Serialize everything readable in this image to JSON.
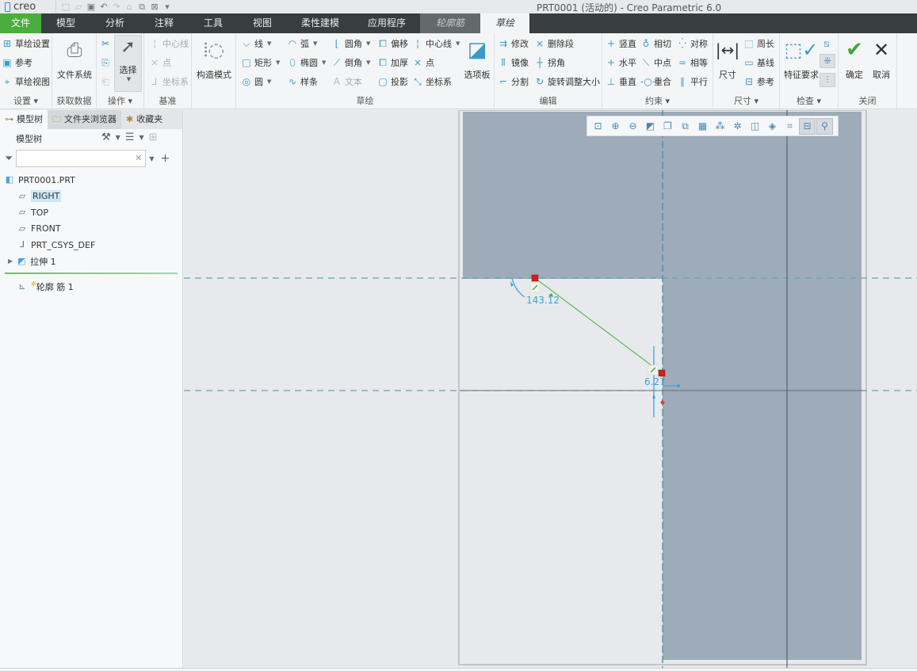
{
  "app": {
    "logo": "creo",
    "window_title": "PRT0001 (活动的) - Creo Parametric 6.0"
  },
  "quick_access": [
    {
      "icon": "new-file-icon",
      "glyph": "□",
      "dim": true
    },
    {
      "icon": "open-file-icon",
      "glyph": "▱",
      "dim": true
    },
    {
      "icon": "save-icon",
      "glyph": "▣",
      "dim": false
    },
    {
      "icon": "undo-icon",
      "glyph": "↶",
      "dim": false
    },
    {
      "icon": "redo-icon",
      "glyph": "↷",
      "dim": true
    },
    {
      "icon": "regenerate-icon",
      "glyph": "⌂",
      "dim": true
    },
    {
      "icon": "windows-icon",
      "glyph": "⧉",
      "dim": false
    },
    {
      "icon": "close-window-icon",
      "glyph": "⊠",
      "dim": false
    },
    {
      "icon": "customize-icon",
      "glyph": "▾",
      "dim": false
    }
  ],
  "tabs": [
    {
      "label": "文件",
      "kind": "file",
      "width": 52
    },
    {
      "label": "模型",
      "kind": "normal",
      "width": 62
    },
    {
      "label": "分析",
      "kind": "normal",
      "width": 62
    },
    {
      "label": "注释",
      "kind": "normal",
      "width": 62
    },
    {
      "label": "工具",
      "kind": "normal",
      "width": 62
    },
    {
      "label": "视图",
      "kind": "normal",
      "width": 62
    },
    {
      "label": "柔性建模",
      "kind": "normal",
      "width": 84
    },
    {
      "label": "应用程序",
      "kind": "normal",
      "width": 84
    },
    {
      "label": "轮廓筋",
      "kind": "ctx",
      "width": 76
    },
    {
      "label": "草绘",
      "kind": "active",
      "width": 62
    }
  ],
  "ribbon": {
    "setup": {
      "label": "设置 ▾",
      "items": [
        {
          "label": "草绘设置",
          "icon": "sketch-setup-icon",
          "glyph": "⊞"
        },
        {
          "label": "参考",
          "icon": "references-icon",
          "glyph": "▣"
        },
        {
          "label": "草绘视图",
          "icon": "sketch-view-icon",
          "glyph": "⌖"
        }
      ]
    },
    "get_data": {
      "label": "获取数据",
      "file_system": "文件系统"
    },
    "operations": {
      "label": "操作 ▾",
      "select": "选择",
      "cut_icon": "✂",
      "copy_icon": "⎘",
      "paste_icon": "⎗"
    },
    "datum": {
      "label": "基准",
      "items": [
        {
          "label": "中心线",
          "icon": "centerline-icon",
          "glyph": "¦"
        },
        {
          "label": "点",
          "icon": "point-icon",
          "glyph": "×"
        },
        {
          "label": "坐标系",
          "icon": "csys-icon",
          "glyph": "⅃"
        }
      ]
    },
    "construction": {
      "label": "构造模式"
    },
    "sketching": {
      "label": "草绘",
      "col1": [
        {
          "label": "线",
          "icon": "line-icon",
          "glyph": "⌵",
          "dropdown": true
        },
        {
          "label": "矩形",
          "icon": "rectangle-icon",
          "glyph": "□",
          "dropdown": true
        },
        {
          "label": "圆",
          "icon": "circle-icon",
          "glyph": "◎",
          "dropdown": true
        }
      ],
      "col2": [
        {
          "label": "弧",
          "icon": "arc-icon",
          "glyph": "◠",
          "dropdown": true
        },
        {
          "label": "椭圆",
          "icon": "ellipse-icon",
          "glyph": "⬯",
          "dropdown": true
        },
        {
          "label": "样条",
          "icon": "spline-icon",
          "glyph": "∿",
          "dropdown": false
        }
      ],
      "col3": [
        {
          "label": "圆角",
          "icon": "fillet-icon",
          "glyph": "⌊",
          "dropdown": true
        },
        {
          "label": "倒角",
          "icon": "chamfer-icon",
          "glyph": "⟋",
          "dropdown": true
        },
        {
          "label": "文本",
          "icon": "text-icon",
          "glyph": "A",
          "dropdown": false,
          "dim": true
        }
      ],
      "col4": [
        {
          "label": "偏移",
          "icon": "offset-icon",
          "glyph": "⧠"
        },
        {
          "label": "加厚",
          "icon": "thicken-icon",
          "glyph": "⧠"
        },
        {
          "label": "投影",
          "icon": "project-icon",
          "glyph": "▢"
        }
      ],
      "col5": [
        {
          "label": "中心线",
          "icon": "sketch-centerline-icon",
          "glyph": "¦",
          "dropdown": true
        },
        {
          "label": "点",
          "icon": "sketch-point-icon",
          "glyph": "×",
          "dropdown": false
        },
        {
          "label": "坐标系",
          "icon": "sketch-csys-icon",
          "glyph": "⤡",
          "dropdown": false
        }
      ],
      "palette": "选项板"
    },
    "editing": {
      "label": "编辑",
      "col1": [
        {
          "label": "修改",
          "icon": "modify-icon",
          "glyph": "⇉"
        },
        {
          "label": "镜像",
          "icon": "mirror-icon",
          "glyph": "⫴"
        },
        {
          "label": "分割",
          "icon": "divide-icon",
          "glyph": "⌐"
        }
      ],
      "col2": [
        {
          "label": "删除段",
          "icon": "delete-segment-icon",
          "glyph": "⨯"
        },
        {
          "label": "拐角",
          "icon": "corner-icon",
          "glyph": "┼"
        },
        {
          "label": "旋转调整大小",
          "icon": "rotate-resize-icon",
          "glyph": "↻"
        }
      ]
    },
    "constrain": {
      "label": "约束 ▾",
      "col1": [
        {
          "label": "竖直",
          "icon": "vertical-icon",
          "glyph": "+"
        },
        {
          "label": "水平",
          "icon": "horizontal-icon",
          "glyph": "+"
        },
        {
          "label": "垂直",
          "icon": "perpendicular-icon",
          "glyph": "⊥"
        }
      ],
      "col2": [
        {
          "label": "相切",
          "icon": "tangent-icon",
          "glyph": "♁"
        },
        {
          "label": "中点",
          "icon": "midpoint-icon",
          "glyph": "⟍"
        },
        {
          "label": "重合",
          "icon": "coincident-icon",
          "glyph": "-○-"
        }
      ],
      "col3": [
        {
          "label": "对称",
          "icon": "symmetric-icon",
          "glyph": "⁛"
        },
        {
          "label": "相等",
          "icon": "equal-icon",
          "glyph": "="
        },
        {
          "label": "平行",
          "icon": "parallel-icon",
          "glyph": "∥"
        }
      ]
    },
    "dimension": {
      "label": "尺寸 ▾",
      "main": "尺寸",
      "items": [
        {
          "label": "周长",
          "icon": "perimeter-icon",
          "glyph": "⬚"
        },
        {
          "label": "基线",
          "icon": "baseline-icon",
          "glyph": "▭"
        },
        {
          "label": "参考",
          "icon": "reference-dim-icon",
          "glyph": "⊟"
        }
      ]
    },
    "inspect": {
      "label": "检查 ▾",
      "feature_req": "特征要求"
    },
    "close": {
      "label": "关闭",
      "ok": "确定",
      "cancel": "取消"
    }
  },
  "left_panel": {
    "tabs": [
      {
        "label": "模型树",
        "icon": "model-tree-icon",
        "glyph": "⊶"
      },
      {
        "label": "文件夹浏览器",
        "icon": "folder-browser-icon",
        "glyph": "🗀"
      },
      {
        "label": "收藏夹",
        "icon": "favorites-icon",
        "glyph": "✱"
      }
    ],
    "header": "模型树",
    "filter_placeholder": "",
    "tree": [
      {
        "label": "PRT0001.PRT",
        "icon": "part-icon",
        "glyph": "◧",
        "indent": 0,
        "selected": false,
        "expand": false
      },
      {
        "label": "RIGHT",
        "icon": "datum-plane-icon",
        "glyph": "▱",
        "indent": 1,
        "selected": true,
        "expand": false
      },
      {
        "label": "TOP",
        "icon": "datum-plane-icon",
        "glyph": "▱",
        "indent": 1,
        "selected": false,
        "expand": false
      },
      {
        "label": "FRONT",
        "icon": "datum-plane-icon",
        "glyph": "▱",
        "indent": 1,
        "selected": false,
        "expand": false
      },
      {
        "label": "PRT_CSYS_DEF",
        "icon": "coordinate-system-icon",
        "glyph": "⅃",
        "indent": 1,
        "selected": false,
        "expand": false
      },
      {
        "label": "拉伸 1",
        "icon": "extrude-icon",
        "glyph": "◩",
        "indent": 1,
        "selected": false,
        "expand": true
      }
    ],
    "insert_item": {
      "label": "轮廓 筋 1",
      "icon": "profile-rib-icon",
      "glyph": "⊾"
    }
  },
  "view_toolbar": [
    {
      "icon": "refit-icon",
      "glyph": "⊡",
      "on": false
    },
    {
      "icon": "zoom-in-icon",
      "glyph": "⊕",
      "on": false
    },
    {
      "icon": "zoom-out-icon",
      "glyph": "⊖",
      "on": false
    },
    {
      "icon": "repaint-icon",
      "glyph": "◩",
      "on": false
    },
    {
      "icon": "display-style-icon",
      "glyph": "❒",
      "on": false
    },
    {
      "icon": "saved-orientations-icon",
      "glyph": "⧉",
      "on": false
    },
    {
      "icon": "view-manager-icon",
      "glyph": "▦",
      "on": false
    },
    {
      "icon": "datum-display-icon",
      "glyph": "⁂",
      "on": false
    },
    {
      "icon": "spin-center-icon",
      "glyph": "✲",
      "on": false
    },
    {
      "icon": "annotation-display-icon",
      "glyph": "◫",
      "on": false
    },
    {
      "icon": "sketch-view-orient-icon",
      "glyph": "◈",
      "on": false
    },
    {
      "icon": "sketcher-display-icon",
      "glyph": "⌗",
      "on": false
    },
    {
      "icon": "constraint-display-icon",
      "glyph": "⊟",
      "on": true
    },
    {
      "icon": "vertex-display-icon",
      "glyph": "⚲",
      "on": true
    }
  ],
  "sketch": {
    "dimension_angle": "143.12",
    "dimension_length": "6.27",
    "colors": {
      "part_fill": "#9eabb9",
      "canvas_bg": "#e8e9ec",
      "reference_line": "#5aa9b8",
      "sketch_line": "#3cb043",
      "dimension": "#3aa6d6",
      "endpoint": "#d0211c",
      "accent_green": "#4aad3d"
    }
  }
}
